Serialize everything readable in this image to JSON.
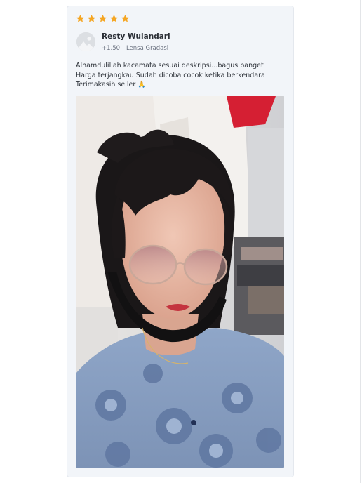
{
  "review": {
    "rating": 5,
    "star_color": "#f5a623",
    "star_icon": "star-icon",
    "avatar_icon": "default-avatar-icon",
    "reviewer_name": "Resty Wulandari",
    "meta": {
      "sizing": "+1.50",
      "variant": "Lensa Gradasi"
    },
    "text_lines": [
      "Alhamdulillah kacamata sesuai deskripsi...bagus banget",
      "Harga terjangkau Sudah dicoba cocok ketika berkendara",
      "Terimakasih seller 🙏"
    ],
    "photo": {
      "description_icon": "review-photo"
    }
  }
}
